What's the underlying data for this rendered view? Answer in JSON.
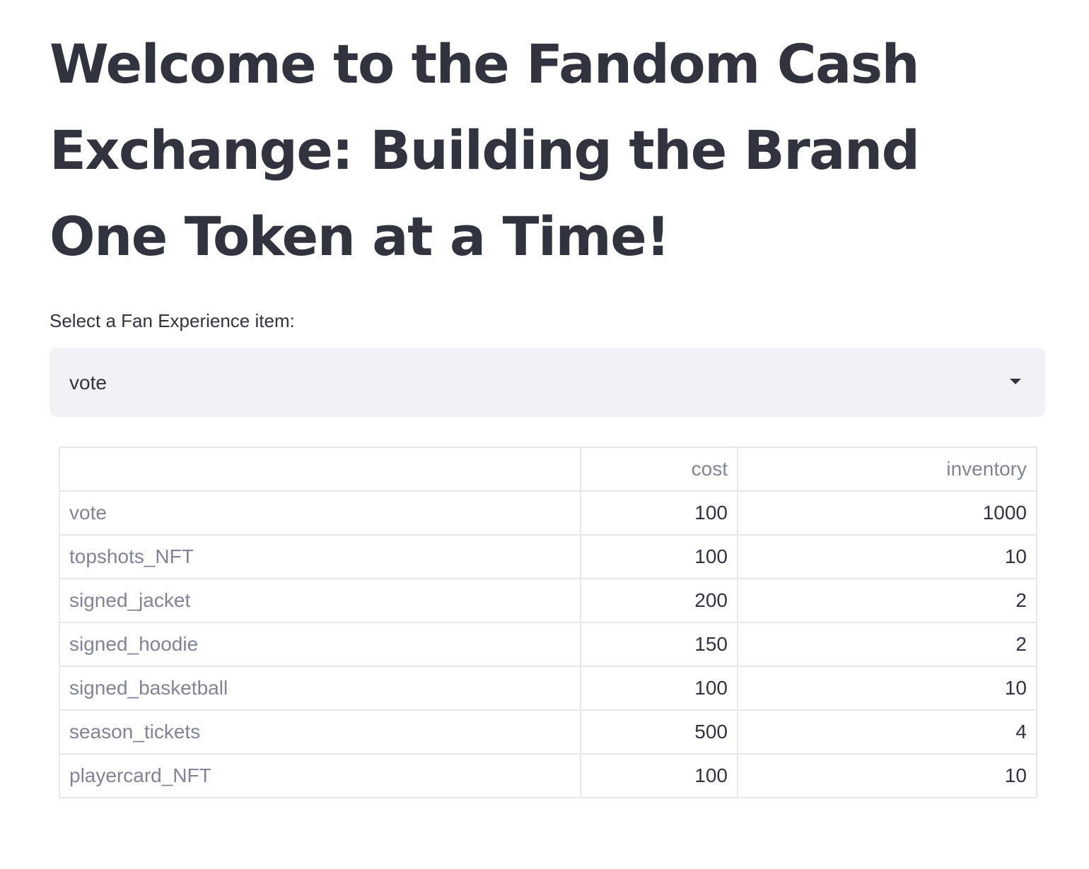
{
  "header": {
    "title": "Welcome to the Fandom Cash Exchange: Building the Brand One Token at a Time!"
  },
  "selector": {
    "label": "Select a Fan Experience item:",
    "selected_value": "vote"
  },
  "table": {
    "columns": [
      "",
      "cost",
      "inventory"
    ],
    "rows": [
      {
        "name": "vote",
        "cost": "100",
        "inventory": "1000"
      },
      {
        "name": "topshots_NFT",
        "cost": "100",
        "inventory": "10"
      },
      {
        "name": "signed_jacket",
        "cost": "200",
        "inventory": "2"
      },
      {
        "name": "signed_hoodie",
        "cost": "150",
        "inventory": "2"
      },
      {
        "name": "signed_basketball",
        "cost": "100",
        "inventory": "10"
      },
      {
        "name": "season_tickets",
        "cost": "500",
        "inventory": "4"
      },
      {
        "name": "playercard_NFT",
        "cost": "100",
        "inventory": "10"
      }
    ]
  },
  "colors": {
    "text": "#31333f",
    "muted_text": "#808495",
    "select_background": "#f0f2f6",
    "table_border": "#e6e8ec"
  }
}
